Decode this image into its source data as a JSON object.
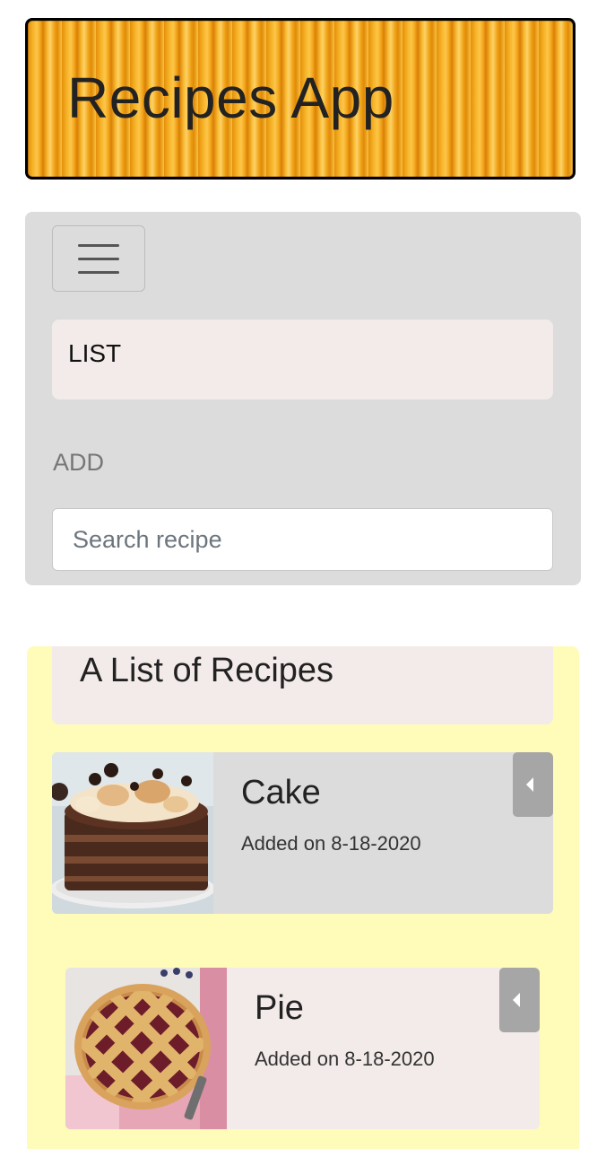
{
  "header": {
    "title": "Recipes App"
  },
  "nav": {
    "menu_icon": "hamburger-menu-icon",
    "list_label": "LIST",
    "add_label": "ADD",
    "search_placeholder": "Search recipe",
    "search_value": ""
  },
  "recipes": {
    "heading": "A List of Recipes",
    "items": [
      {
        "name": "Cake",
        "date": "Added on 8-18-2020",
        "image": "chocolate-cake-image",
        "toggle_icon": "caret-left-icon"
      },
      {
        "name": "Pie",
        "date": "Added on 8-18-2020",
        "image": "lattice-pie-image",
        "toggle_icon": "caret-left-icon"
      }
    ]
  },
  "colors": {
    "banner_orange": "#f2a416",
    "nav_background": "#dcdcdc",
    "list_item_background": "#f3ebe9",
    "section_yellow": "#fffbb9",
    "toggle_gray": "#a6a6a6"
  }
}
